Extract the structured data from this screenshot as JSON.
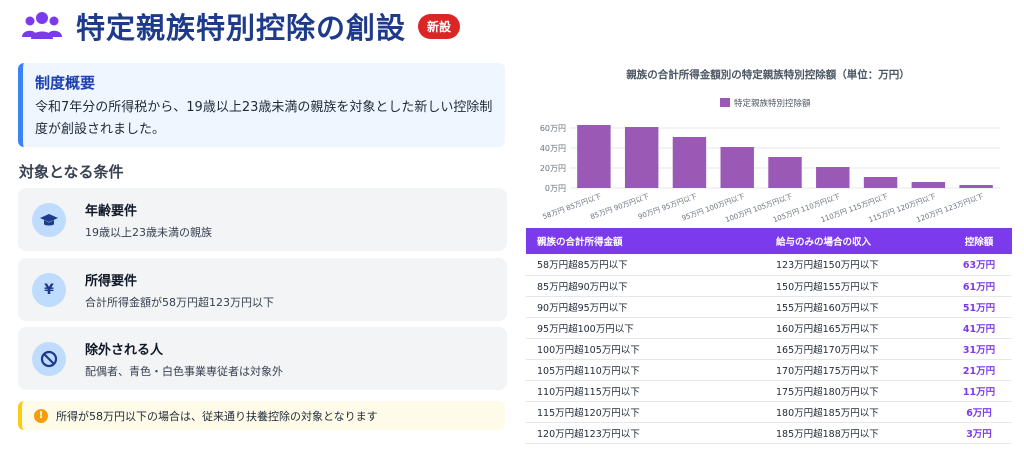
{
  "header": {
    "title": "特定親族特別控除の創設",
    "badge": "新設",
    "icon": "users-icon",
    "accent_color": "#1e3a8a",
    "badge_color": "#dc2626"
  },
  "overview": {
    "title": "制度概要",
    "line1": "令和7年分の所得税から、19歳以上23歳未満の親族を対象とした新しい控除制",
    "line2": "度が創設されました。"
  },
  "conditions": {
    "title": "対象となる条件",
    "items": [
      {
        "icon": "graduation-cap-icon",
        "label": "年齢要件",
        "desc": "19歳以上23歳未満の親族"
      },
      {
        "icon": "yen-icon",
        "label": "所得要件",
        "desc": "合計所得金額が58万円超123万円以下"
      },
      {
        "icon": "prohibited-icon",
        "label": "除外される人",
        "desc": "配偶者、青色・白色事業専従者は対象外"
      }
    ]
  },
  "note": {
    "icon": "info-icon",
    "text": "所得が58万円以下の場合は、従来通り扶養控除の対象となります"
  },
  "chart_data": {
    "type": "bar",
    "title": "親族の合計所得金額別の特定親族特別控除額（単位：万円）",
    "categories": [
      "58万円 85万円以下",
      "85万円 90万円以下",
      "90万円 95万円以下",
      "95万円 100万円以下",
      "100万円 105万円以下",
      "105万円 110万円以下",
      "110万円 115万円以下",
      "115万円 120万円以下",
      "120万円 123万円以下"
    ],
    "series": [
      {
        "name": "特定親族特別控除額",
        "values": [
          63,
          61,
          51,
          41,
          31,
          21,
          11,
          6,
          3
        ],
        "color": "#9b59b6"
      }
    ],
    "yticks": [
      "0万円",
      "20万円",
      "40万円",
      "60万円"
    ],
    "ylim": [
      0,
      70
    ],
    "grid": true,
    "legend": "top"
  },
  "table": {
    "headers": [
      "親族の合計所得金額",
      "給与のみの場合の収入",
      "控除額"
    ],
    "rows": [
      [
        "58万円超85万円以下",
        "123万円超150万円以下",
        "63万円"
      ],
      [
        "85万円超90万円以下",
        "150万円超155万円以下",
        "61万円"
      ],
      [
        "90万円超95万円以下",
        "155万円超160万円以下",
        "51万円"
      ],
      [
        "95万円超100万円以下",
        "160万円超165万円以下",
        "41万円"
      ],
      [
        "100万円超105万円以下",
        "165万円超170万円以下",
        "31万円"
      ],
      [
        "105万円超110万円以下",
        "170万円超175万円以下",
        "21万円"
      ],
      [
        "110万円超115万円以下",
        "175万円超180万円以下",
        "11万円"
      ],
      [
        "115万円超120万円以下",
        "180万円超185万円以下",
        "6万円"
      ],
      [
        "120万円超123万円以下",
        "185万円超188万円以下",
        "3万円"
      ]
    ],
    "header_color": "#7c3aed"
  }
}
